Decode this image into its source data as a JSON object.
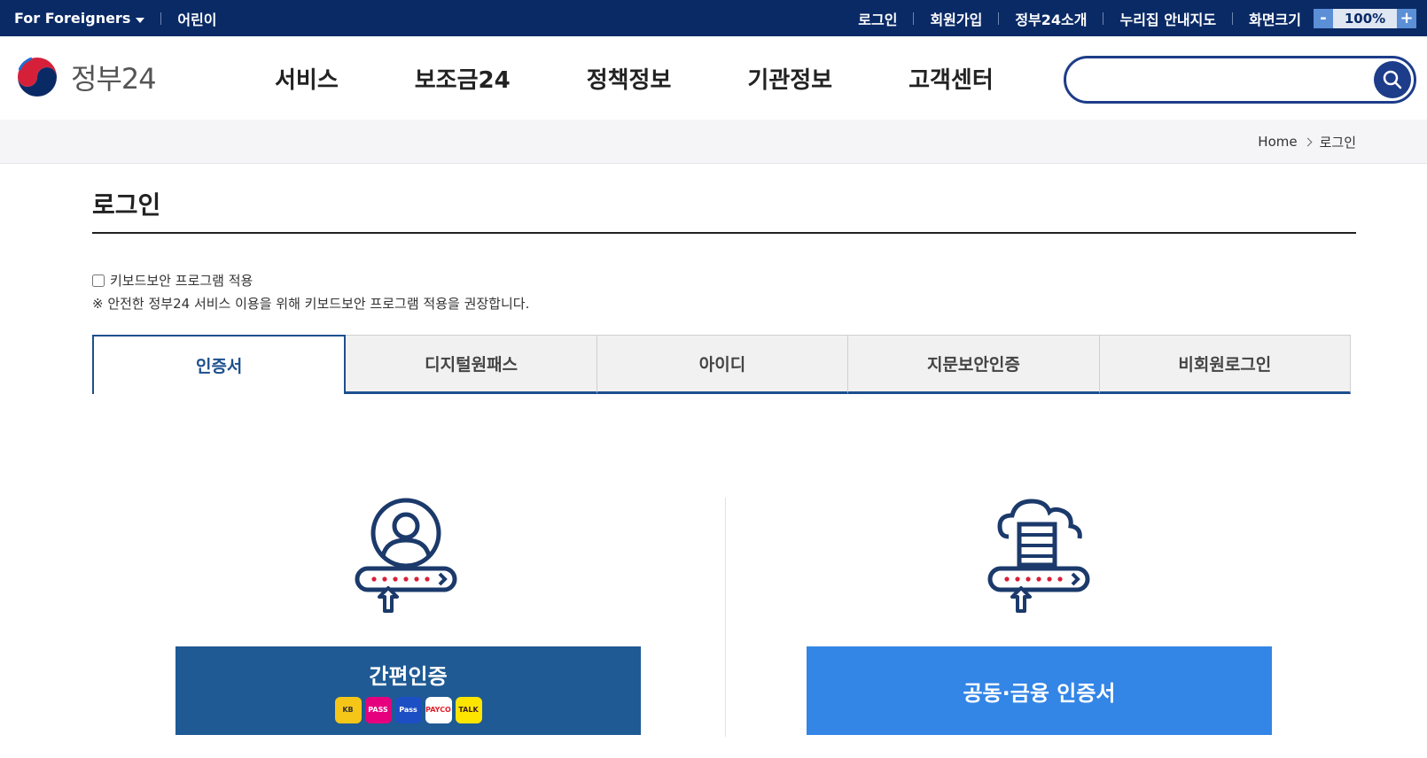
{
  "topbar": {
    "foreigners": "For Foreigners",
    "kids": "어린이",
    "links": [
      "로그인",
      "회원가입",
      "정부24소개",
      "누리집 안내지도"
    ],
    "zoom_label": "화면크기",
    "zoom_minus": "-",
    "zoom_value": "100%",
    "zoom_plus": "+"
  },
  "header": {
    "logo_text": "정부24",
    "nav": [
      "서비스",
      "보조금24",
      "정책정보",
      "기관정보",
      "고객센터"
    ],
    "search_placeholder": ""
  },
  "breadcrumb": {
    "home": "Home",
    "current": "로그인"
  },
  "page": {
    "title": "로그인",
    "keyboard_security_label": "키보드보안 프로그램 적용",
    "keyboard_security_note": "※ 안전한 정부24 서비스 이용을 위해 키보드보안 프로그램 적용을 권장합니다."
  },
  "tabs": [
    "인증서",
    "디지털원패스",
    "아이디",
    "지문보안인증",
    "비회원로그인"
  ],
  "login_options": {
    "simple_auth_label": "간편인증",
    "simple_auth_providers": [
      {
        "name": "KB",
        "bg": "#f5c518",
        "fg": "#333"
      },
      {
        "name": "PASS",
        "bg": "#e6007e",
        "fg": "#ffffff"
      },
      {
        "name": "Pass",
        "bg": "#1d4fc4",
        "fg": "#ffffff"
      },
      {
        "name": "PAYCO",
        "bg": "#ffffff",
        "fg": "#e0202a"
      },
      {
        "name": "TALK",
        "bg": "#fee500",
        "fg": "#3a1d1d"
      }
    ],
    "joint_cert_label": "공동·금융 인증서"
  },
  "colors": {
    "topbar_bg": "#0a2a66",
    "tab_active": "#1d4f8f",
    "simple_btn": "#1f5a94",
    "cert_btn": "#3385e6"
  }
}
